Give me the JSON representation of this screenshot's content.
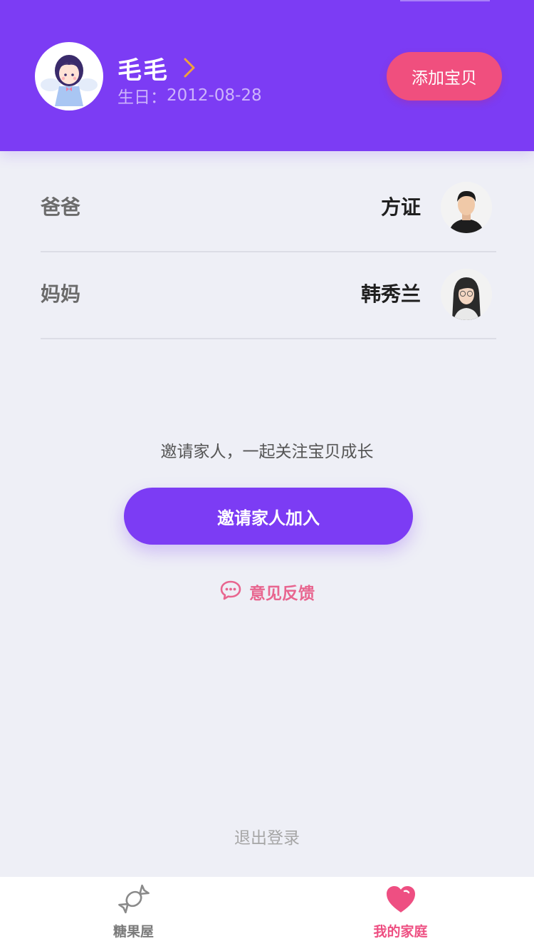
{
  "header": {
    "baby_name": "毛毛",
    "birthday_label": "生日：",
    "birthday_value": "2012-08-28",
    "add_baby_label": "添加宝贝"
  },
  "family": {
    "members": [
      {
        "role": "爸爸",
        "name": "方证"
      },
      {
        "role": "妈妈",
        "name": "韩秀兰"
      }
    ]
  },
  "invite": {
    "prompt": "邀请家人，一起关注宝贝成长",
    "button_label": "邀请家人加入"
  },
  "feedback": {
    "label": "意见反馈"
  },
  "logout": {
    "label": "退出登录"
  },
  "tabbar": {
    "tabs": [
      {
        "label": "糖果屋",
        "icon": "candy-icon",
        "active": false
      },
      {
        "label": "我的家庭",
        "icon": "heart-icon",
        "active": true
      }
    ]
  },
  "colors": {
    "primary": "#7c3cf4",
    "accent_pink": "#f04f7e",
    "background": "#eeeff6"
  }
}
